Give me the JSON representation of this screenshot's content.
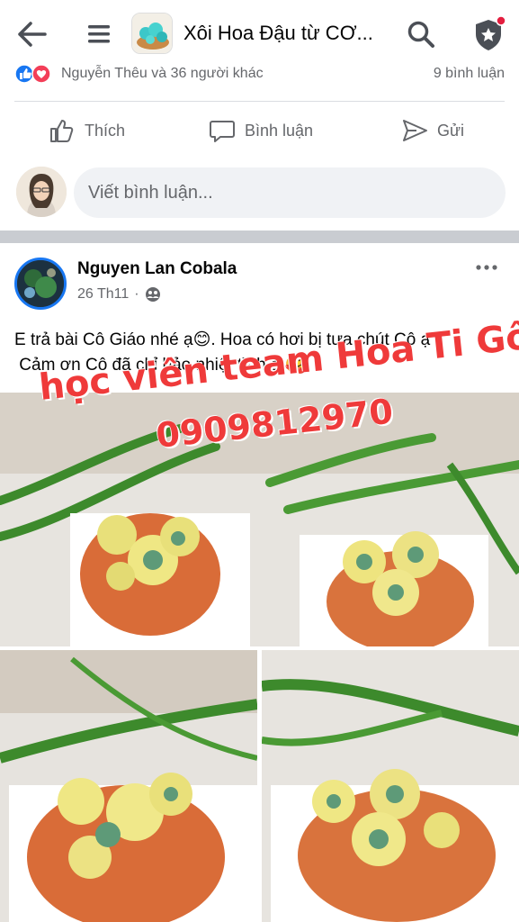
{
  "header": {
    "title": "Xôi Hoa Đậu từ CƠ...",
    "back_icon": "arrow-left-icon",
    "menu_icon": "menu-icon",
    "search_icon": "search-icon",
    "shield_icon": "shield-star-icon",
    "notification_dot_color": "#e41e3f"
  },
  "reactions": {
    "text": "Nguyễn Thêu và 36 người khác",
    "comments": "9 bình luận",
    "like_color": "#1877f2",
    "love_color": "#f33e58"
  },
  "actions": {
    "like": "Thích",
    "comment": "Bình luận",
    "send": "Gửi"
  },
  "comment_box": {
    "placeholder": "Viết bình luận..."
  },
  "post": {
    "author": "Nguyen Lan Cobala",
    "date": "26 Th11",
    "privacy_icon": "group-audience-icon",
    "line1": "E trả bài Cô Giáo nhé ạ😊. Hoa có hơi bị tưa chút Cô ạ",
    "line2": " Cảm ơn Cô đã chỉ bảo nhiệt tình ạ 🥰",
    "watermark_line1": "học viên team Hoa Ti Gôn",
    "watermark_line2": "0909812970"
  },
  "colors": {
    "accent": "#1877f2",
    "secondary_text": "#65676b",
    "divider": "#dadde1",
    "watermark": "#ef3a3a"
  }
}
